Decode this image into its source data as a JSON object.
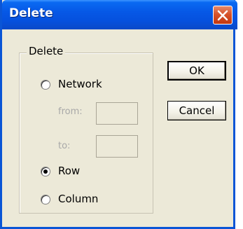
{
  "window": {
    "title": "Delete"
  },
  "group": {
    "label": "Delete",
    "options": [
      {
        "label": "Network",
        "selected": false
      },
      {
        "label": "Row",
        "selected": true
      },
      {
        "label": "Column",
        "selected": false
      }
    ],
    "from_label": "from:",
    "to_label": "to:",
    "from_value": "",
    "to_value": ""
  },
  "buttons": {
    "ok": "OK",
    "cancel": "Cancel"
  },
  "colors": {
    "titlebar": "#0658e6",
    "close_button": "#d7532b",
    "dialog_background": "#ece9d8"
  },
  "icons": {
    "close": "close-icon"
  }
}
